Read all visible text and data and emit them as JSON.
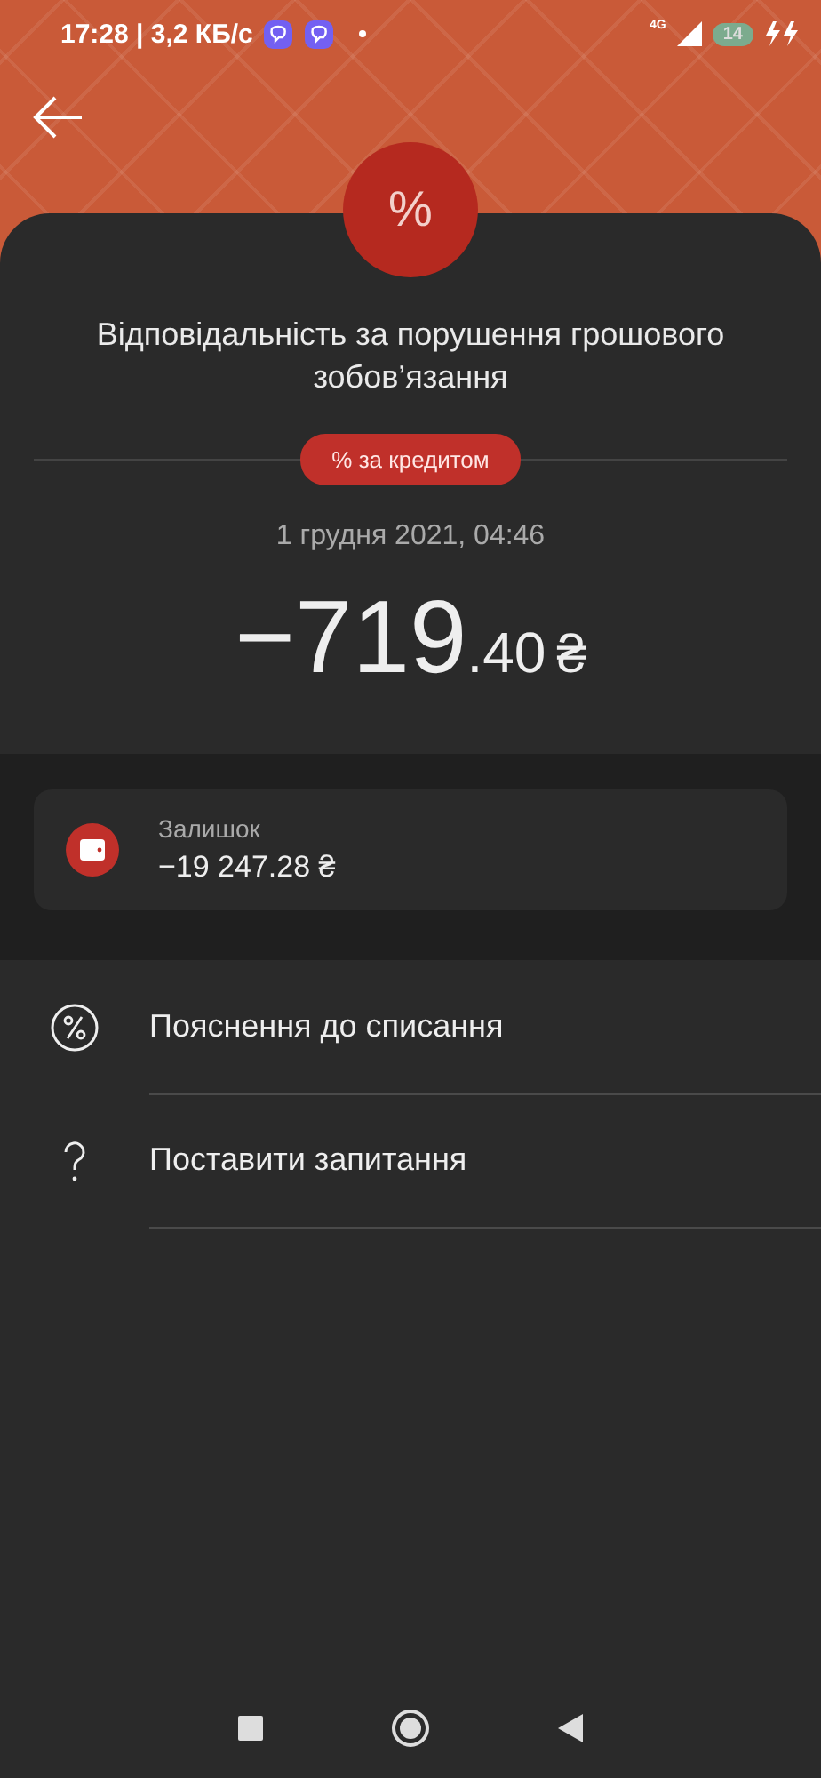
{
  "status_bar": {
    "time_speed": "17:28 | 3,2 КБ/с",
    "network": "4G",
    "battery": "14"
  },
  "header": {
    "symbol": "%"
  },
  "transaction": {
    "title": "Відповідальність за порушення грошового зобов’язання",
    "category": "% за кредитом",
    "date": "1 грудня 2021, 04:46",
    "amount": {
      "whole": "−719",
      "fraction": ".40",
      "currency": "₴"
    }
  },
  "balance": {
    "label": "Залишок",
    "value": "−19 247.28 ₴"
  },
  "actions": [
    {
      "kind": "percent",
      "label": "Пояснення до списання"
    },
    {
      "kind": "question",
      "label": "Поставити запитання"
    }
  ]
}
